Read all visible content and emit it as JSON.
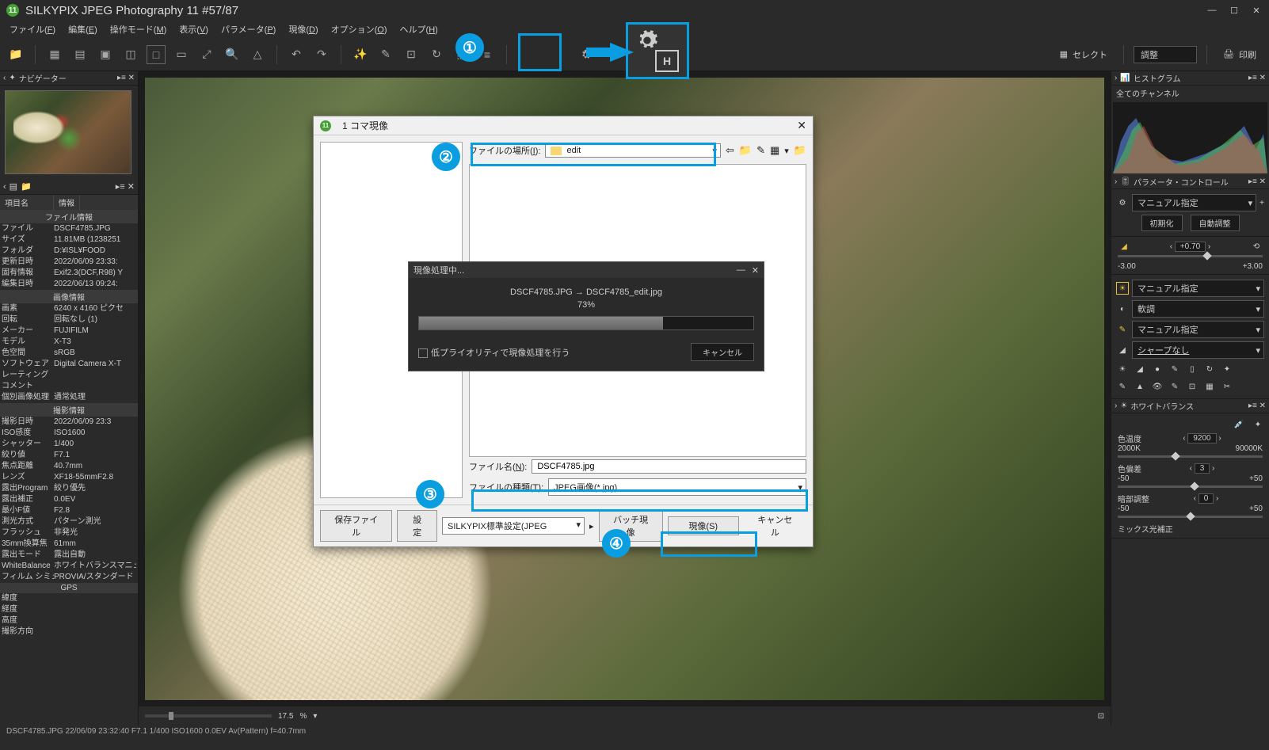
{
  "title": "SILKYPIX JPEG Photography 11    #57/87",
  "menu": {
    "file": "ファイル(",
    "file_k": "F",
    "edit": "編集(",
    "edit_k": "E",
    "mode": "操作モード(",
    "mode_k": "M",
    "view": "表示(",
    "view_k": "V",
    "param": "パラメータ(",
    "param_k": "P",
    "dev": "現像(",
    "dev_k": "D",
    "opt": "オプション(",
    "opt_k": "O",
    "help": "ヘルプ(",
    "help_k": "H",
    "close": ")"
  },
  "toolbar": {
    "select": "セレクト",
    "adjust": "調整",
    "print": "印刷"
  },
  "navigator": {
    "title": "ナビゲーター"
  },
  "info": {
    "header": {
      "col1": "項目名",
      "col2": "情報"
    },
    "sections": {
      "file": "ファイル情報",
      "image": "画像情報",
      "shoot": "撮影情報",
      "gps": "GPS"
    },
    "file_rows": [
      {
        "k": "ファイル",
        "v": "DSCF4785.JPG"
      },
      {
        "k": "サイズ",
        "v": "11.81MB (1238251"
      },
      {
        "k": "フォルダ",
        "v": "D:¥ISL¥FOOD"
      },
      {
        "k": "更新日時",
        "v": "2022/06/09 23:33:"
      },
      {
        "k": "固有情報",
        "v": "Exif2.3(DCF,R98) Y"
      },
      {
        "k": "編集日時",
        "v": "2022/06/13 09:24:"
      }
    ],
    "image_rows": [
      {
        "k": "画素",
        "v": "6240 x 4160 ピクセ"
      },
      {
        "k": "回転",
        "v": "回転なし (1)"
      },
      {
        "k": "メーカー",
        "v": "FUJIFILM"
      },
      {
        "k": "モデル",
        "v": "X-T3"
      },
      {
        "k": "色空間",
        "v": "sRGB"
      },
      {
        "k": "ソフトウェア",
        "v": "Digital Camera X-T"
      },
      {
        "k": "レーティング",
        "v": ""
      },
      {
        "k": "コメント",
        "v": ""
      },
      {
        "k": "個別画像処理",
        "v": "通常処理"
      }
    ],
    "shoot_rows": [
      {
        "k": "撮影日時",
        "v": "2022/06/09 23:3"
      },
      {
        "k": "ISO感度",
        "v": "ISO1600"
      },
      {
        "k": "シャッター",
        "v": "1/400"
      },
      {
        "k": "絞り値",
        "v": "F7.1"
      },
      {
        "k": "焦点距離",
        "v": "40.7mm"
      },
      {
        "k": "レンズ",
        "v": "XF18-55mmF2.8"
      },
      {
        "k": "露出Program",
        "v": "絞り優先"
      },
      {
        "k": "露出補正",
        "v": "0.0EV"
      },
      {
        "k": "最小F値",
        "v": "F2.8"
      },
      {
        "k": "測光方式",
        "v": "パターン測光"
      },
      {
        "k": "フラッシュ",
        "v": "非発光"
      },
      {
        "k": "35mm換算焦",
        "v": "61mm"
      },
      {
        "k": "露出モード",
        "v": "露出自動"
      },
      {
        "k": "WhiteBalance",
        "v": "ホワイトバランスマニュア"
      },
      {
        "k": "フィルム シミュレ",
        "v": "PROVIA/スタンダード"
      }
    ],
    "gps_rows": [
      {
        "k": "緯度",
        "v": ""
      },
      {
        "k": "経度",
        "v": ""
      },
      {
        "k": "高度",
        "v": ""
      },
      {
        "k": "撮影方向",
        "v": ""
      }
    ]
  },
  "zoom": {
    "value": "17.5",
    "unit": "%"
  },
  "right": {
    "histo": "ヒストグラム",
    "channels": "全てのチャンネル",
    "param_ctrl": "パラメータ・コントロール",
    "preset": "マニュアル指定",
    "init": "初期化",
    "auto": "自動調整",
    "exp_val": "+0.70",
    "exp_min": "-3.00",
    "exp_max": "+3.00",
    "wb_preset": "マニュアル指定",
    "tone": "軟調",
    "sharp_preset": "マニュアル指定",
    "sharp": "シャープなし",
    "wb_panel": "ホワイトバランス",
    "color_temp": "色温度",
    "ct_min": "2000K",
    "ct_val": "9200",
    "ct_max": "90000K",
    "color_dev": "色偏差",
    "cd_min": "-50",
    "cd_val": "3",
    "cd_max": "+50",
    "dark": "暗部調整",
    "dk_min": "-50",
    "dk_val": "0",
    "dk_max": "+50",
    "mix": "ミックス光補正"
  },
  "status": "DSCF4785.JPG 22/06/09 23:32:40 F7.1 1/400 ISO1600  0.0EV Av(Pattern) f=40.7mm",
  "dialog": {
    "title": "1 コマ現像",
    "loc_label": "ファイルの場所(",
    "loc_k": "I",
    "close_paren": "):",
    "folder": "edit",
    "name_label": "ファイル名(",
    "name_k": "N",
    "name_val": "DSCF4785.jpg",
    "type_label": "ファイルの種類(",
    "type_k": "T",
    "type_val": "JPEG画像(*.jpg)",
    "save_file": "保存ファイル",
    "settings": "設定",
    "quality": "SILKYPIX標準設定(JPEG",
    "batch": "バッチ現像",
    "develop": "現像(",
    "develop_k": "S",
    "cancel": "キャンセル"
  },
  "progress": {
    "title": "現像処理中...",
    "file": "DSCF4785.JPG → DSCF4785_edit.jpg",
    "percent": "73%",
    "low_priority": "低プライオリティで現像処理を行う",
    "cancel": "キャンセル"
  },
  "annot": {
    "n1": "①",
    "n2": "②",
    "n3": "③",
    "n4": "④"
  }
}
